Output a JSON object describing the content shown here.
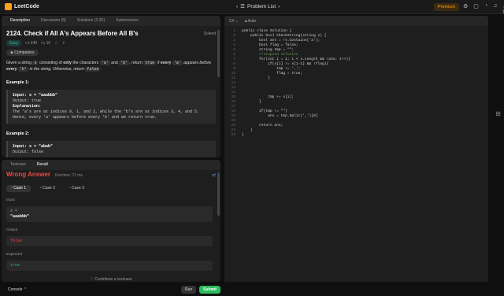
{
  "topbar": {
    "logo": "LeetCode",
    "problem_list": "Problem List",
    "premium": "Premium",
    "count": "0"
  },
  "tabs": [
    "Description",
    "Discussion (8)",
    "Solutions (2.2K)",
    "Submissions"
  ],
  "problem": {
    "title": "2124. Check if All A's Appears Before All B's",
    "solved": "Solved",
    "difficulty": "Easy",
    "likes": "549",
    "dislikes": "16",
    "companies": "Companies",
    "statement_a": "Given a string",
    "statement_code1": "s",
    "statement_b": "consisting of",
    "statement_only": "only",
    "statement_c": "the characters",
    "statement_code2": "'a'",
    "statement_d": "and",
    "statement_code3": "'b'",
    "statement_e": ", return",
    "statement_code4": "true",
    "statement_f": "if",
    "statement_every1": "every",
    "statement_code5": "'a'",
    "statement_g": "appears before",
    "statement_every2": "every",
    "statement_code6": "'b'",
    "statement_h": "in the string. Otherwise, return",
    "statement_code7": "false",
    "statement_end": ".",
    "example1_title": "Example 1:",
    "example1_lines": [
      "Input: s = \"aaabbb\"",
      "Output: true",
      "Explanation:",
      "The 'a's are at indices 0, 1, and 2, while the 'b's are at indices 3, 4, and 5.",
      "Hence, every 'a' appears before every 'b' and we return true."
    ],
    "example2_title": "Example 2:",
    "example2_lines": [
      "Input: s = \"abab\"",
      "Output: false"
    ]
  },
  "result": {
    "tabs": [
      "Testcase",
      "Result"
    ],
    "status": "Wrong Answer",
    "runtime": "Runtime: 71 ms",
    "cases": [
      "Case 1",
      "Case 2",
      "Case 3"
    ],
    "input_label": "Input",
    "input_var": "s =",
    "input_value": "\"aaabbb\"",
    "output_label": "Output",
    "output_value": "false",
    "expected_label": "Expected",
    "expected_value": "true",
    "contribute": "Contribute a testcase"
  },
  "bottom": {
    "console": "Console",
    "run": "Run",
    "submit": "Submit"
  },
  "editor": {
    "language": "C#",
    "mode": "Auto",
    "lines": [
      {
        "n": "1",
        "t": "public class Solution {"
      },
      {
        "n": "2",
        "t": "    public bool CheckString(string s) {"
      },
      {
        "n": "3",
        "t": "        bool ans = !s.Contains('a');"
      },
      {
        "n": "4",
        "t": "        bool flag = false;"
      },
      {
        "n": "5",
        "t": "        string tmp = \"\";"
      },
      {
        "n": "6",
        "t": "        //stupied solution"
      },
      {
        "n": "7",
        "t": "        for(int i = 1; i < s.Length && !ans; i++){"
      },
      {
        "n": "8",
        "t": "            if(s[i] != s[i-1] && !flag){"
      },
      {
        "n": "9",
        "t": "                tmp += ',';"
      },
      {
        "n": "10",
        "t": "                flag = true;"
      },
      {
        "n": "11",
        "t": "            }"
      },
      {
        "n": "12",
        "t": ""
      },
      {
        "n": "13",
        "t": ""
      },
      {
        "n": "14",
        "t": ""
      },
      {
        "n": "15",
        "t": "            tmp += s[i];"
      },
      {
        "n": "16",
        "t": "        }"
      },
      {
        "n": "17",
        "t": ""
      },
      {
        "n": "18",
        "t": "        if(tmp != \"\")"
      },
      {
        "n": "19",
        "t": "            ans = tmp.Split(',')[0]"
      },
      {
        "n": "20",
        "t": ""
      },
      {
        "n": "21",
        "t": "        return ans;"
      },
      {
        "n": "22",
        "t": "    }"
      },
      {
        "n": "23",
        "t": "}"
      }
    ]
  },
  "colors": {
    "accent": "#ffa116",
    "wrong": "#ef4743",
    "success": "#2cbb5d",
    "easy": "#1cbaba"
  }
}
